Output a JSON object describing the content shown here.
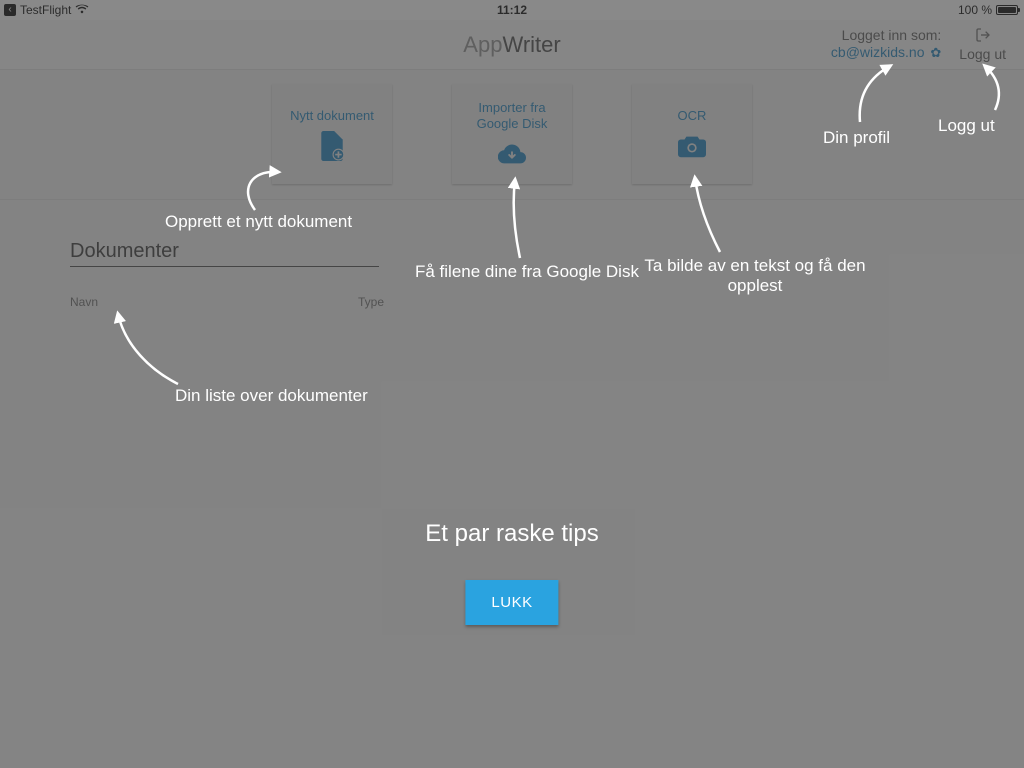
{
  "status_bar": {
    "app_source": "TestFlight",
    "time": "11:12",
    "battery_text": "100 %"
  },
  "header": {
    "title_prefix": "App",
    "title_suffix": "Writer",
    "logged_in_label": "Logget inn som:",
    "email": "cb@wizkids.no",
    "logout_label": "Logg ut"
  },
  "actions": {
    "new_doc": "Nytt dokument",
    "import_gdrive": "Importer fra Google Disk",
    "ocr": "OCR"
  },
  "docs": {
    "section_title": "Dokumenter",
    "col_name": "Navn",
    "col_type": "Type"
  },
  "tips": {
    "new_doc": "Opprett et nytt dokument",
    "gdrive": "Få filene dine fra Google Disk",
    "ocr": "Ta bilde av en tekst og få den opplest",
    "profile": "Din profil",
    "logout": "Logg ut",
    "doclist": "Din liste over dokumenter",
    "heading": "Et par raske tips",
    "close": "LUKK"
  }
}
